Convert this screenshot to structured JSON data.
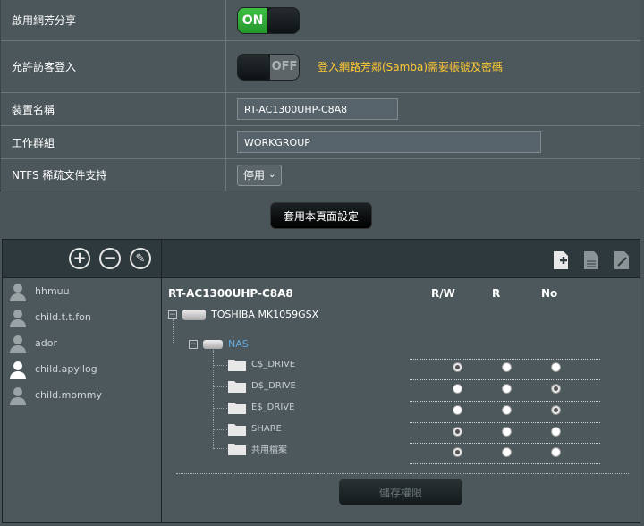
{
  "settings": {
    "enable_share_label": "啟用網芳分享",
    "enable_share_state": "ON",
    "guest_login_label": "允許訪客登入",
    "guest_login_state": "OFF",
    "guest_hint": "登入網路芳鄰(Samba)需要帳號及密碼",
    "device_name_label": "裝置名稱",
    "device_name_value": "RT-AC1300UHP-C8A8",
    "workgroup_label": "工作群組",
    "workgroup_value": "WORKGROUP",
    "ntfs_label": "NTFS 稀疏文件支持",
    "ntfs_value": "停用"
  },
  "apply_button": "套用本頁面設定",
  "users": [
    {
      "name": "hhmuu"
    },
    {
      "name": "child.t.t.fon"
    },
    {
      "name": "ador"
    },
    {
      "name": "child.apyllog"
    },
    {
      "name": "child.mommy"
    }
  ],
  "tree": {
    "device": "RT-AC1300UHP-C8A8",
    "columns": [
      "R/W",
      "R",
      "No"
    ],
    "disk": "TOSHIBA MK1059GSX",
    "volume": "NAS",
    "folders": [
      {
        "name": "C$_DRIVE",
        "perm": "rw"
      },
      {
        "name": "D$_DRIVE",
        "perm": "no"
      },
      {
        "name": "E$_DRIVE",
        "perm": "no"
      },
      {
        "name": "SHARE",
        "perm": "rw"
      },
      {
        "name": "共用檔案",
        "perm": "rw"
      }
    ]
  },
  "save_button": "儲存權限",
  "colors": {
    "accent_on": "#2e9e34",
    "hint": "#ffc932",
    "nas": "#5fa9e0"
  }
}
